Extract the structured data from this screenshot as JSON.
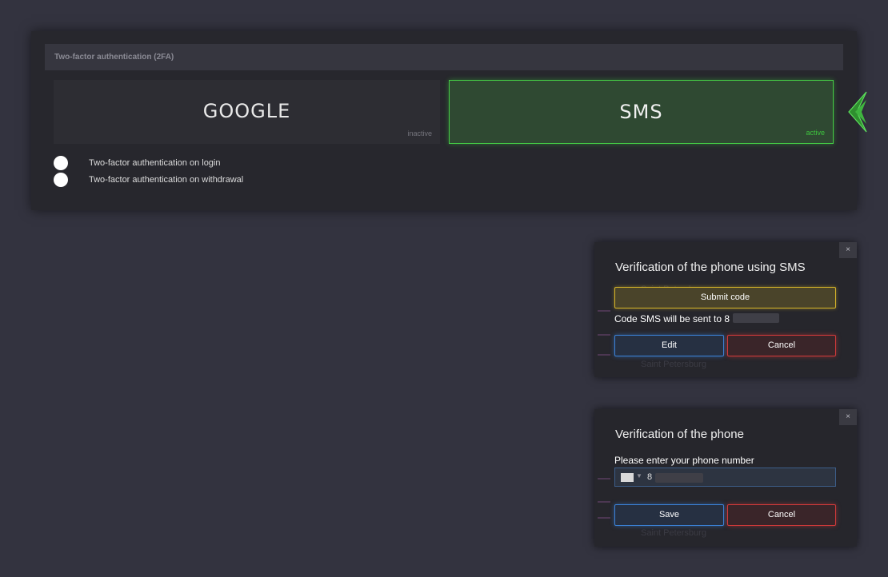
{
  "panel": {
    "header": "Two-factor authentication (2FA)",
    "methods": [
      {
        "name": "GOOGLE",
        "status": "inactive"
      },
      {
        "name": "SMS",
        "status": "active"
      }
    ],
    "toggles": [
      {
        "label": "Two-factor authentication on login"
      },
      {
        "label": "Two-factor authentication on withdrawal"
      }
    ]
  },
  "background_list": {
    "item": "Saint Petersburg"
  },
  "dialog_sms": {
    "close_icon": "×",
    "title": "Verification of the phone using SMS",
    "submit_label": "Submit code",
    "code_text": "Code SMS will be sent to 8",
    "edit_label": "Edit",
    "cancel_label": "Cancel"
  },
  "dialog_phone": {
    "close_icon": "×",
    "title": "Verification of the phone",
    "prompt": "Please enter your phone number",
    "phone_prefix": "8",
    "save_label": "Save",
    "cancel_label": "Cancel"
  },
  "colors": {
    "background": "#33333f",
    "active_green": "#45cc45",
    "accent_yellow": "#d6b429",
    "accent_blue": "#3b82d8",
    "accent_red": "#d23a3a"
  }
}
